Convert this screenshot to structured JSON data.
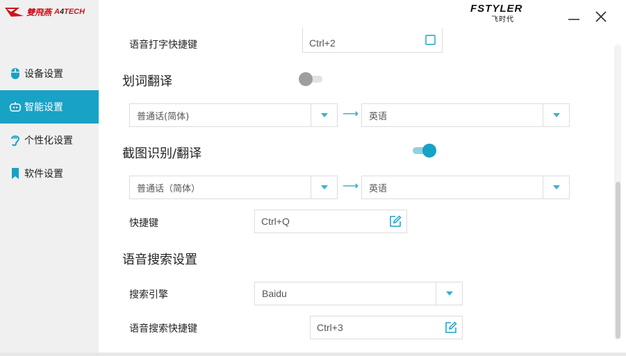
{
  "app": {
    "logo_cn": "雙飛燕",
    "logo_en_prefix": "A",
    "logo_en_suffix": "TECH",
    "brand_top": "FSTYLER",
    "brand_bottom": "飞时代",
    "accent_color": "#17a2c6"
  },
  "sidebar": {
    "items": [
      {
        "label": "设备设置",
        "icon": "mouse-icon",
        "active": false
      },
      {
        "label": "智能设置",
        "icon": "robot-icon",
        "active": true
      },
      {
        "label": "个性化设置",
        "icon": "ear-icon",
        "active": false
      },
      {
        "label": "软件设置",
        "icon": "bookmark-icon",
        "active": false
      }
    ]
  },
  "main": {
    "partial_row": {
      "label": "语音打字快捷键",
      "value": "Ctrl+2"
    },
    "word_translate": {
      "title": "划词翻译",
      "enabled": false,
      "source_lang": "普通话(简体)",
      "target_lang": "英语"
    },
    "screenshot_translate": {
      "title": "截图识别/翻译",
      "enabled": true,
      "source_lang": "普通话（简体）",
      "target_lang": "英语",
      "hotkey_label": "快捷键",
      "hotkey_value": "Ctrl+Q"
    },
    "voice_search": {
      "title": "语音搜索设置",
      "engine_label": "搜索引擎",
      "engine_value": "Baidu",
      "hotkey_label": "语音搜索快捷键",
      "hotkey_value": "Ctrl+3"
    }
  }
}
